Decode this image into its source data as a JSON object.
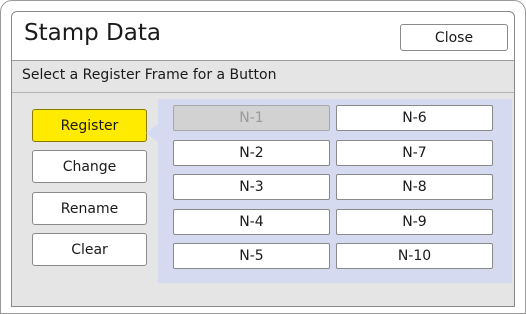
{
  "window": {
    "title": "Stamp Data",
    "close_label": "Close"
  },
  "subtitle": "Select a Register Frame for a Button",
  "actions": [
    {
      "label": "Register",
      "active": true
    },
    {
      "label": "Change",
      "active": false
    },
    {
      "label": "Rename",
      "active": false
    },
    {
      "label": "Clear",
      "active": false
    }
  ],
  "frames": {
    "left": [
      {
        "label": "N-1",
        "disabled": true
      },
      {
        "label": "N-2",
        "disabled": false
      },
      {
        "label": "N-3",
        "disabled": false
      },
      {
        "label": "N-4",
        "disabled": false
      },
      {
        "label": "N-5",
        "disabled": false
      }
    ],
    "right": [
      {
        "label": "N-6",
        "disabled": false
      },
      {
        "label": "N-7",
        "disabled": false
      },
      {
        "label": "N-8",
        "disabled": false
      },
      {
        "label": "N-9",
        "disabled": false
      },
      {
        "label": "N-10",
        "disabled": false
      }
    ]
  },
  "colors": {
    "active_button": "#ffeb00",
    "panel": "#d5daf0",
    "disabled": "#d2d2d2"
  }
}
